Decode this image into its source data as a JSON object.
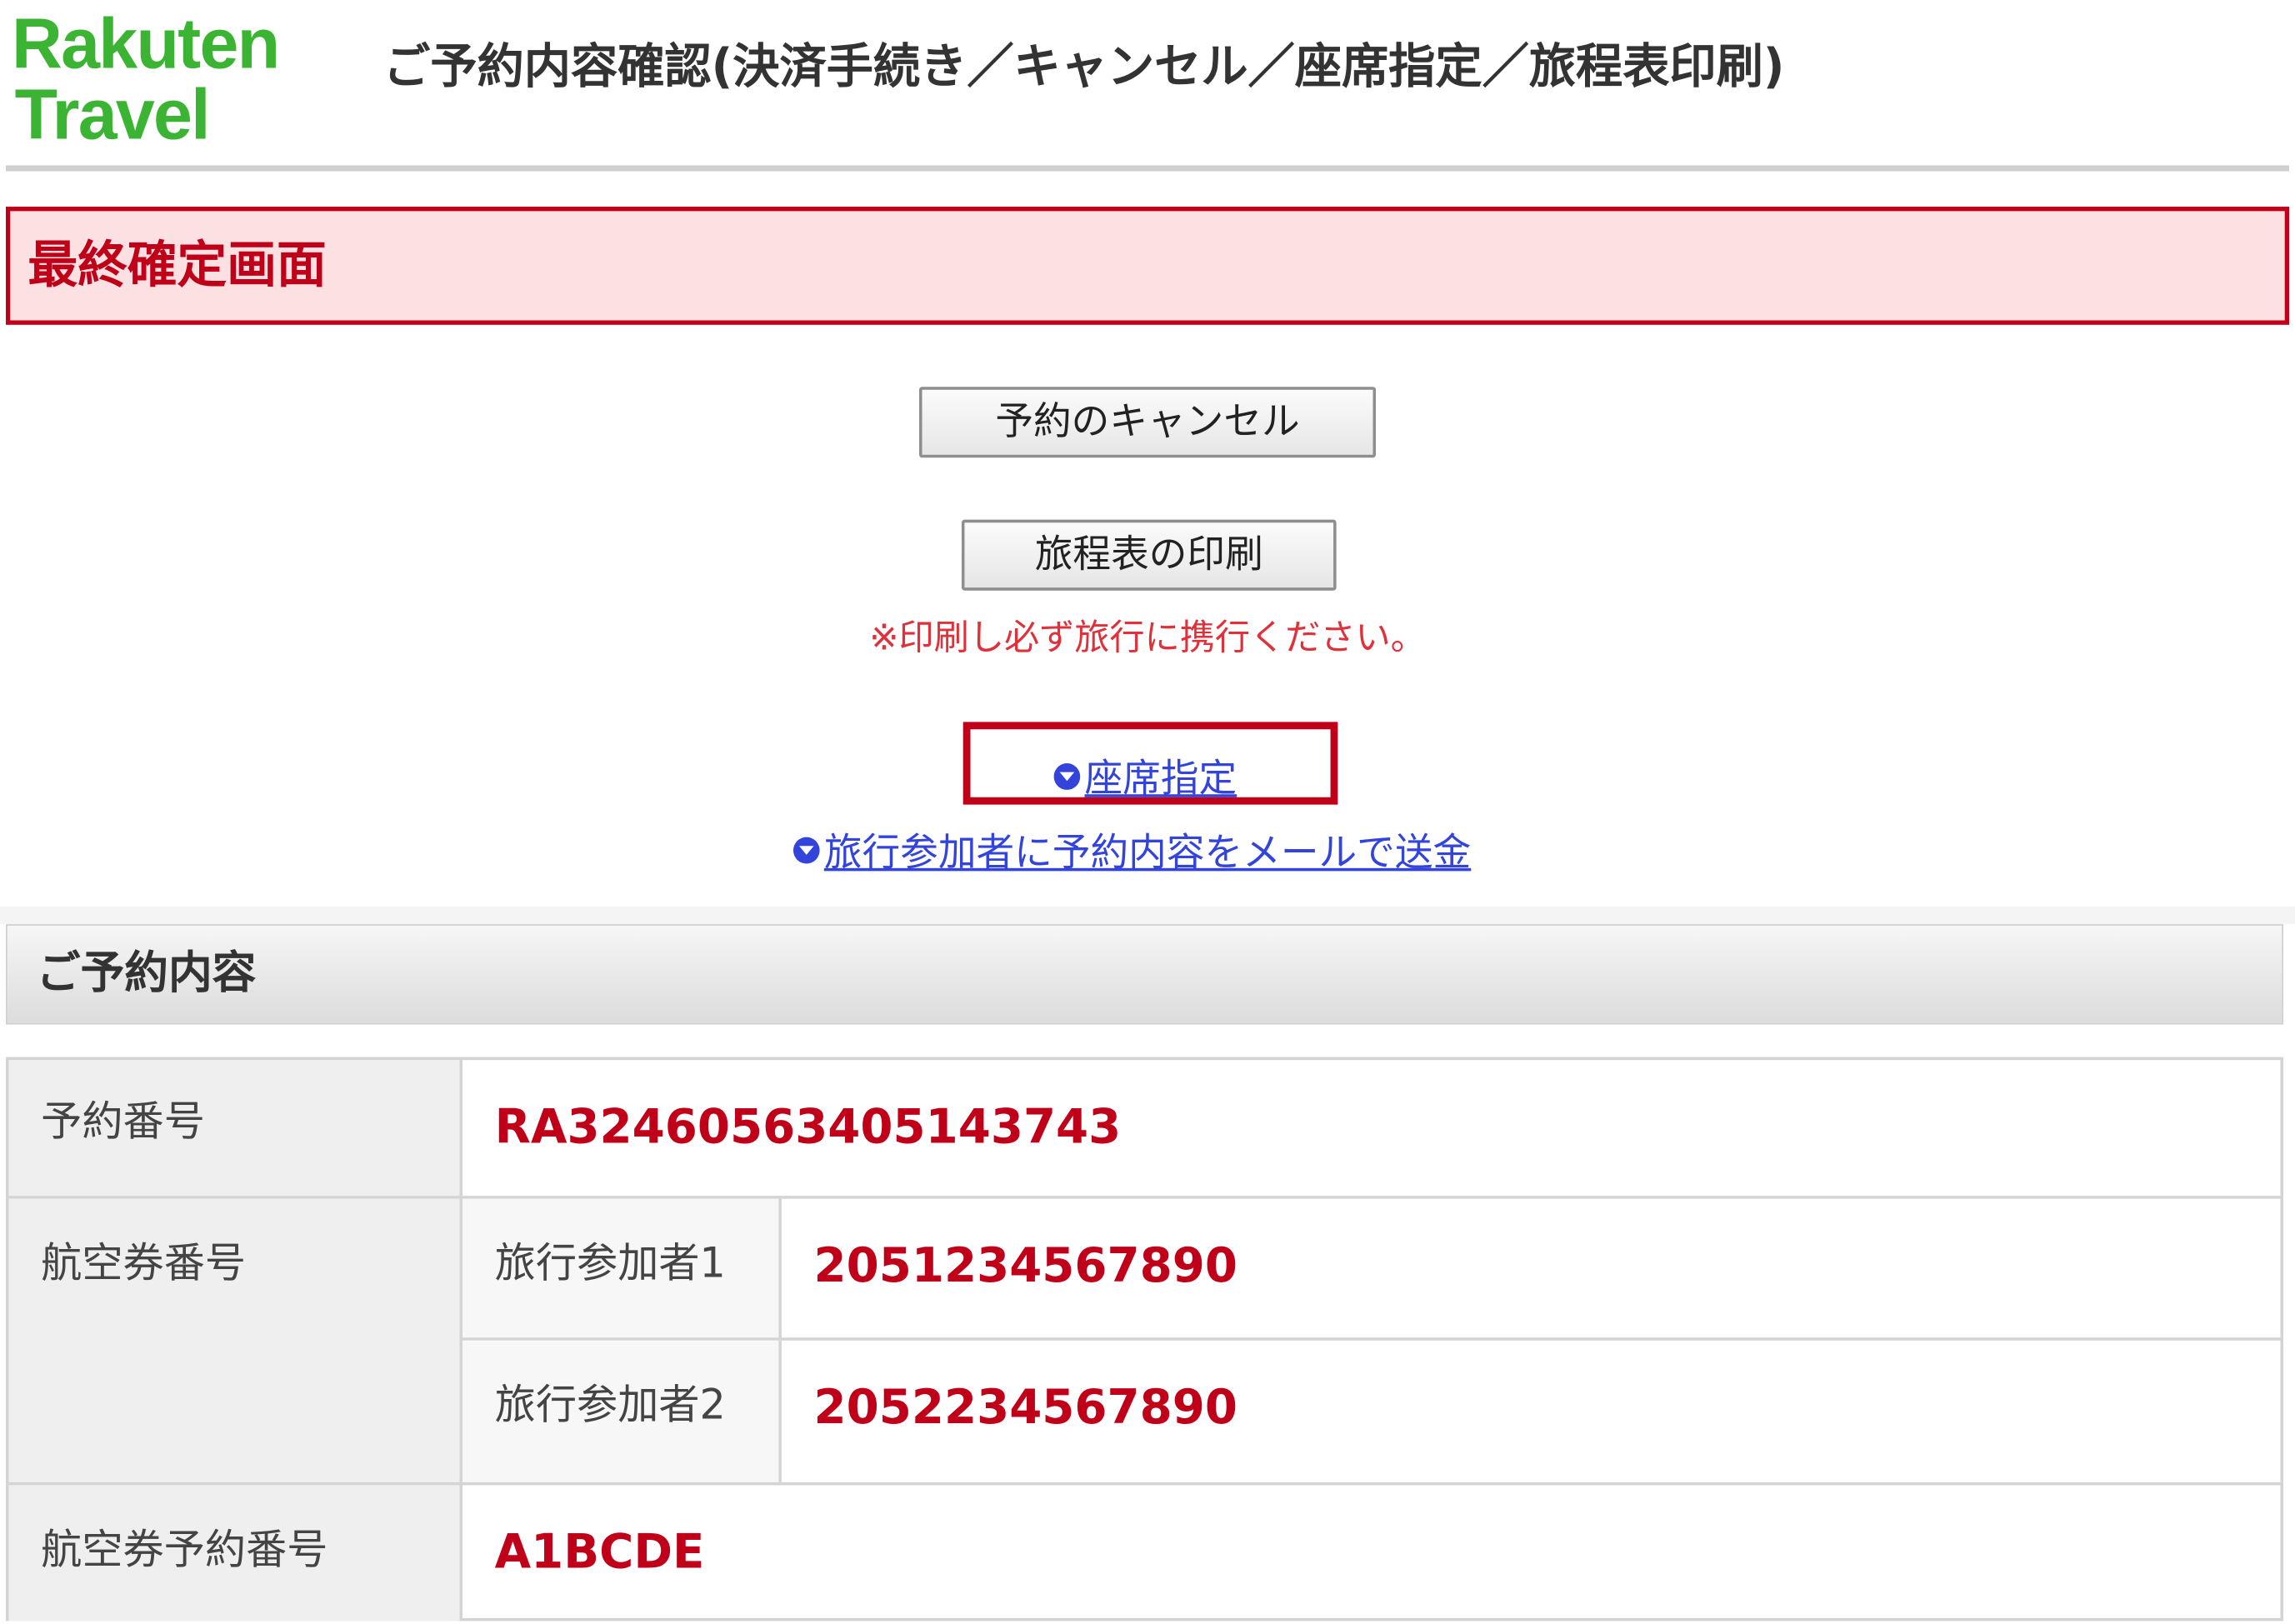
{
  "header": {
    "logo_line1": "Rakuten",
    "logo_line2": "Travel",
    "title": "ご予約内容確認(決済手続き／キャンセル／座席指定／旅程表印刷)"
  },
  "banner": {
    "text": "最終確定画面"
  },
  "actions": {
    "cancel_button": "予約のキャンセル",
    "print_button": "旅程表の印刷",
    "print_note": "※印刷し必ず旅行に携行ください。",
    "seat_link": "座席指定",
    "mail_link": "旅行参加者に予約内容をメールで送金"
  },
  "section": {
    "title": "ご予約内容"
  },
  "reservation": {
    "number_label": "予約番号",
    "number_value": "RA32460563405143743",
    "ticket_label": "航空券番号",
    "travelers": [
      {
        "label": "旅行参加者1",
        "ticket": "2051234567890"
      },
      {
        "label": "旅行参加者2",
        "ticket": "2052234567890"
      }
    ],
    "ticket_booking_label": "航空券予約番号",
    "ticket_booking_value": "A1BCDE"
  },
  "colors": {
    "brand_green": "#3cb433",
    "accent_red": "#c00018",
    "link_blue": "#3344dd",
    "banner_bg": "#fde0e2"
  }
}
